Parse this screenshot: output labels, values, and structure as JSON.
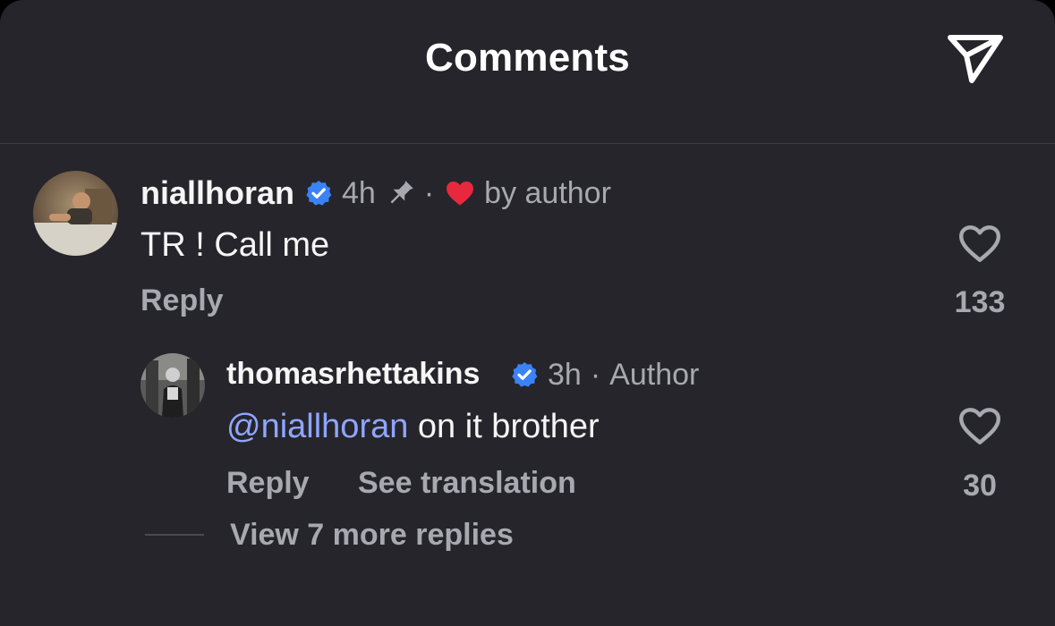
{
  "header": {
    "title": "Comments",
    "share_icon": "paper-plane-icon"
  },
  "comments": [
    {
      "username": "niallhoran",
      "verified_icon": "verified-badge-icon",
      "time": "4h",
      "pinned_icon": "pin-icon",
      "separator": "·",
      "liked_by_author_icon": "red-heart-icon",
      "liked_by_author_text": "by author",
      "text": "TR ! Call me",
      "reply_label": "Reply",
      "like_icon": "heart-outline-icon",
      "like_count": "133"
    }
  ],
  "reply": {
    "username": "thomasrhettakins",
    "verified_icon": "verified-badge-icon",
    "time": "3h",
    "separator": "·",
    "author_tag": "Author",
    "mention": "@niallhoran",
    "text": "on it brother",
    "reply_label": "Reply",
    "translate_label": "See translation",
    "like_icon": "heart-outline-icon",
    "like_count": "30"
  },
  "view_more_replies": "View 7 more replies",
  "colors": {
    "background": "#25252b",
    "text_primary": "#f5f5f5",
    "text_secondary": "#a8a8b0",
    "mention": "#8fa6ff",
    "verified": "#3b82f6",
    "heart": "#e8283c"
  }
}
